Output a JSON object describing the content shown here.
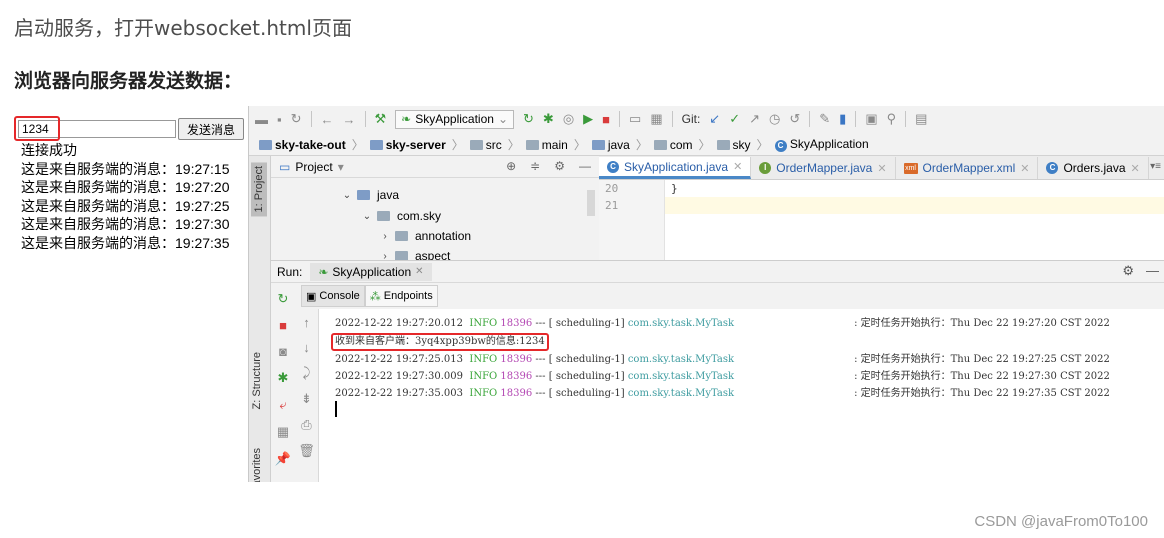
{
  "article": {
    "intro": "启动服务，打开websocket.html页面",
    "heading": "浏览器向服务器发送数据：",
    "watermark": "CSDN @javaFrom0To100"
  },
  "browser": {
    "input_value": "1234",
    "send_label": "发送消息",
    "messages": [
      "连接成功",
      "这是来自服务端的消息：19:27:15",
      "这是来自服务端的消息：19:27:20",
      "这是来自服务端的消息：19:27:25",
      "这是来自服务端的消息：19:27:30",
      "这是来自服务端的消息：19:27:35"
    ]
  },
  "ide": {
    "run_config": "SkyApplication",
    "git_label": "Git:",
    "breadcrumb": [
      "sky-take-out",
      "sky-server",
      "src",
      "main",
      "java",
      "com",
      "sky",
      "SkyApplication"
    ],
    "project": {
      "title": "Project",
      "tree": [
        "java",
        "com.sky",
        "annotation",
        "aspect"
      ]
    },
    "side_tabs": {
      "project": "1: Project",
      "structure": "Z: Structure",
      "favorites": "2: Favorites"
    },
    "editor_tabs": [
      "SkyApplication.java",
      "OrderMapper.java",
      "OrderMapper.xml",
      "Orders.java"
    ],
    "editor": {
      "line_numbers": [
        "20",
        "21"
      ],
      "code_line": "}"
    },
    "run": {
      "label": "Run:",
      "tab": "SkyApplication",
      "console_tab": "Console",
      "endpoints_tab": "Endpoints"
    },
    "logs": [
      {
        "ts": "2022-12-22 19:27:20.012",
        "level": "INFO",
        "pid": "18396",
        "sep": "---",
        "thread": "[   scheduling-1]",
        "logger": "com.sky.task.MyTask",
        "msg": ": 定时任务开始执行：Thu Dec 22 19:27:20 CST 2022"
      },
      {
        "ts": "2022-12-22 19:27:25.013",
        "level": "INFO",
        "pid": "18396",
        "sep": "---",
        "thread": "[   scheduling-1]",
        "logger": "com.sky.task.MyTask",
        "msg": ": 定时任务开始执行：Thu Dec 22 19:27:25 CST 2022"
      },
      {
        "ts": "2022-12-22 19:27:30.009",
        "level": "INFO",
        "pid": "18396",
        "sep": "---",
        "thread": "[   scheduling-1]",
        "logger": "com.sky.task.MyTask",
        "msg": ": 定时任务开始执行：Thu Dec 22 19:27:30 CST 2022"
      },
      {
        "ts": "2022-12-22 19:27:35.003",
        "level": "INFO",
        "pid": "18396",
        "sep": "---",
        "thread": "[   scheduling-1]",
        "logger": "com.sky.task.MyTask",
        "msg": ": 定时任务开始执行：Thu Dec 22 19:27:35 CST 2022"
      }
    ],
    "received_line": "收到来自客户端：3yq4xpp39bw的信息:1234"
  },
  "colors": {
    "highlight_red": "#e5282a",
    "info_green": "#3aa53a",
    "pid_magenta": "#b347b3",
    "logger_teal": "#3e9ca0"
  }
}
